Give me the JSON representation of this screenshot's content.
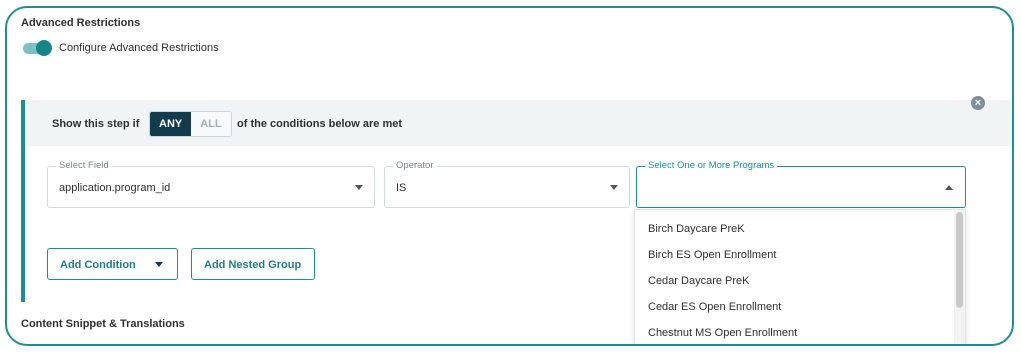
{
  "section": {
    "title": "Advanced Restrictions",
    "toggle_label": "Configure Advanced Restrictions",
    "toggle_on": true
  },
  "condition": {
    "prefix": "Show this step if",
    "mode_options": [
      "ANY",
      "ALL"
    ],
    "mode_selected": "ANY",
    "suffix": "of the conditions below are met",
    "select_field": {
      "legend": "Select Field",
      "value": "application.program_id"
    },
    "operator": {
      "legend": "Operator",
      "value": "IS"
    },
    "programs": {
      "legend": "Select One or More Programs",
      "value": ""
    },
    "add_condition_label": "Add Condition",
    "add_nested_label": "Add Nested Group"
  },
  "dropdown": {
    "options": [
      "Birch Daycare PreK",
      "Birch ES Open Enrollment",
      "Cedar Daycare PreK",
      "Cedar ES Open Enrollment",
      "Chestnut MS Open Enrollment"
    ]
  },
  "next_section": {
    "title": "Content Snippet & Translations"
  },
  "colors": {
    "accent": "#1b8f92",
    "dark": "#133a4d"
  }
}
